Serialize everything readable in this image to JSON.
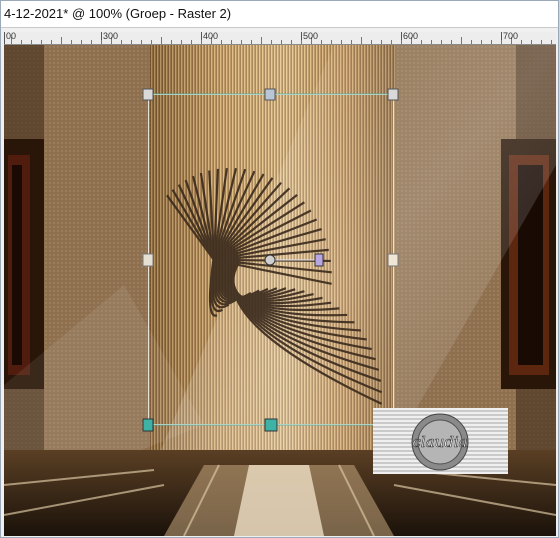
{
  "window": {
    "title": "4-12-2021* @ 100% (Groep - Raster 2)"
  },
  "ruler": {
    "labels": [
      "00",
      "300",
      "400",
      "500",
      "600",
      "700"
    ]
  },
  "canvas": {
    "watermark_text": "claudia",
    "colors": {
      "gold": "#c9a26a",
      "dark_brown": "#2c1d10",
      "cream": "#e8d8bd",
      "handle_teal": "#3fb2a6"
    }
  }
}
